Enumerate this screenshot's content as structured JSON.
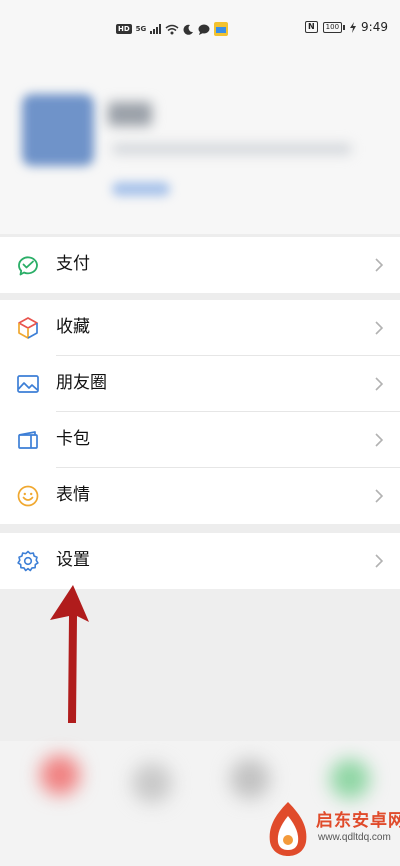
{
  "status_bar": {
    "hd_badge": "HD",
    "network": "5G",
    "battery": "100",
    "time": "9:49"
  },
  "menu": {
    "pay": {
      "label": "支付",
      "icon": "wechat-pay-icon",
      "color": "#2aae67"
    },
    "items": [
      {
        "label": "收藏",
        "icon": "favorites-cube-icon"
      },
      {
        "label": "朋友圈",
        "icon": "moments-image-icon",
        "color": "#3d7fd6"
      },
      {
        "label": "卡包",
        "icon": "card-wallet-icon",
        "color": "#3d7fd6"
      },
      {
        "label": "表情",
        "icon": "emoji-smile-icon",
        "color": "#f0a830"
      }
    ],
    "settings": {
      "label": "设置",
      "icon": "settings-gear-icon",
      "color": "#3d7fd6"
    }
  },
  "annotation": {
    "arrow_color": "#b01c1c"
  },
  "watermark": {
    "title": "启东安卓网",
    "url": "www.qdltdq.com"
  }
}
